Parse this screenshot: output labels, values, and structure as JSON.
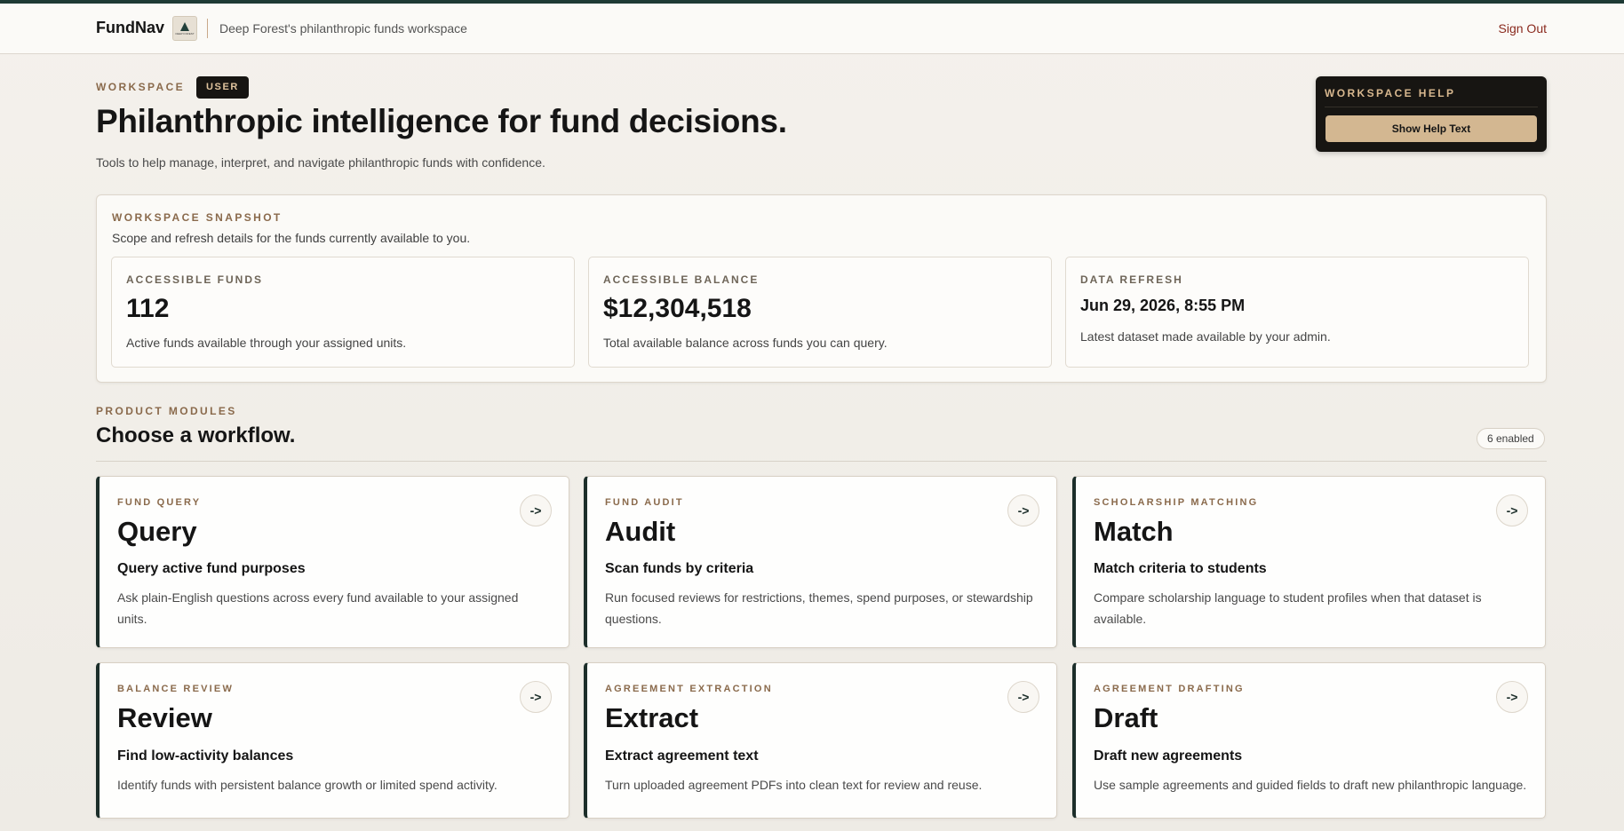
{
  "nav": {
    "brand": "FundNav",
    "logo_text": "DEEP FOREST",
    "workspace_name": "Deep Forest's philanthropic funds workspace",
    "sign_out": "Sign Out"
  },
  "hero": {
    "eyebrow": "WORKSPACE",
    "role_badge": "USER",
    "title": "Philanthropic intelligence for fund decisions.",
    "subtitle": "Tools to help manage, interpret, and navigate philanthropic funds with confidence."
  },
  "help": {
    "title": "WORKSPACE HELP",
    "button": "Show Help Text"
  },
  "snapshot": {
    "eyebrow": "WORKSPACE SNAPSHOT",
    "description": "Scope and refresh details for the funds currently available to you.",
    "stats": [
      {
        "label": "ACCESSIBLE FUNDS",
        "value": "112",
        "desc": "Active funds available through your assigned units."
      },
      {
        "label": "ACCESSIBLE BALANCE",
        "value": "$12,304,518",
        "desc": "Total available balance across funds you can query."
      },
      {
        "label": "DATA REFRESH",
        "value": "Jun 29, 2026, 8:55 PM",
        "desc": "Latest dataset made available by your admin."
      }
    ]
  },
  "modules": {
    "eyebrow": "PRODUCT MODULES",
    "title": "Choose a workflow.",
    "enabled": "6 enabled",
    "arrow": "->",
    "cards": [
      {
        "eyebrow": "FUND QUERY",
        "title": "Query",
        "heading": "Query active fund purposes",
        "desc": "Ask plain-English questions across every fund available to your assigned units."
      },
      {
        "eyebrow": "FUND AUDIT",
        "title": "Audit",
        "heading": "Scan funds by criteria",
        "desc": "Run focused reviews for restrictions, themes, spend purposes, or stewardship questions."
      },
      {
        "eyebrow": "SCHOLARSHIP MATCHING",
        "title": "Match",
        "heading": "Match criteria to students",
        "desc": "Compare scholarship language to student profiles when that dataset is available."
      },
      {
        "eyebrow": "BALANCE REVIEW",
        "title": "Review",
        "heading": "Find low-activity balances",
        "desc": "Identify funds with persistent balance growth or limited spend activity."
      },
      {
        "eyebrow": "AGREEMENT EXTRACTION",
        "title": "Extract",
        "heading": "Extract agreement text",
        "desc": "Turn uploaded agreement PDFs into clean text for review and reuse."
      },
      {
        "eyebrow": "AGREEMENT DRAFTING",
        "title": "Draft",
        "heading": "Draft new agreements",
        "desc": "Use sample agreements and guided fields to draft new philanthropic language."
      }
    ]
  },
  "colors": {
    "accent_dark": "#1c2e2a",
    "eyebrow": "#8a6a4c",
    "help_button": "#d3b791",
    "sign_out": "#8a2a1e"
  }
}
